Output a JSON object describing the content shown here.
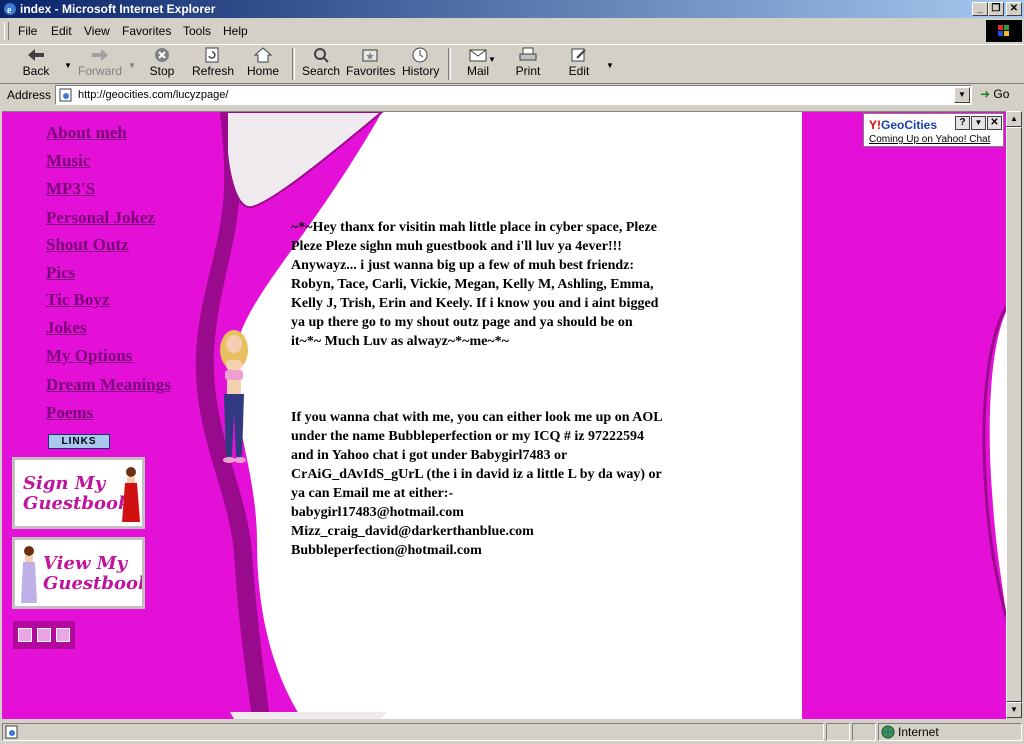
{
  "window": {
    "title": "index - Microsoft Internet Explorer"
  },
  "menu": [
    "File",
    "Edit",
    "View",
    "Favorites",
    "Tools",
    "Help"
  ],
  "toolbar": {
    "back": "Back",
    "forward": "Forward",
    "stop": "Stop",
    "refresh": "Refresh",
    "home": "Home",
    "search": "Search",
    "favorites": "Favorites",
    "history": "History",
    "mail": "Mail",
    "print": "Print",
    "edit": "Edit"
  },
  "address": {
    "label": "Address",
    "url": "http://geocities.com/lucyzpage/",
    "go": "Go"
  },
  "geocities": {
    "logo_y": "Y!",
    "logo_text": "GeoCities",
    "help": "?",
    "dropdown": "▼",
    "close": "✕",
    "link": "Coming Up on Yahoo! Chat"
  },
  "nav": [
    "About meh",
    "Music",
    "MP3'S",
    "Personal Jokez",
    "Shout Outz",
    "Pics",
    "Tic Boyz",
    "Jokes",
    "My Options",
    "Dream Meanings",
    "Poems"
  ],
  "links_button": "LINKS",
  "guestbook": {
    "sign": "Sign My Guestbook",
    "view": "View My Guestbook"
  },
  "content": {
    "para1": "~*~Hey thanx for visitin mah little place in cyber space, Pleze Pleze Pleze sighn muh guestbook and i'll luv ya 4ever!!! Anywayz... i just wanna big up a few of muh best friendz: Robyn, Tace, Carli, Vickie, Megan, Kelly M, Ashling, Emma, Kelly J, Trish, Erin and Keely. If i know you and i aint bigged ya up there go to my shout outz page and ya should be on it~*~ Much Luv as alwayz~*~me~*~",
    "para2": "If you wanna chat with me, you can either look me up on AOL under the name Bubbleperfection or my ICQ # iz 97222594 and in Yahoo chat i got under Babygirl7483 or CrAiG_dAvIdS_gUrL (the i in david iz a little L by da way) or ya can Email me at either:-",
    "emails": [
      "babygirl17483@hotmail.com",
      "Mizz_craig_david@darkerthanblue.com",
      "Bubbleperfection@hotmail.com"
    ]
  },
  "status": {
    "zone": "Internet"
  },
  "colors": {
    "page_pink": "#e410d8",
    "dark_purple": "#7a0078",
    "titlebar": "#0a246a"
  }
}
